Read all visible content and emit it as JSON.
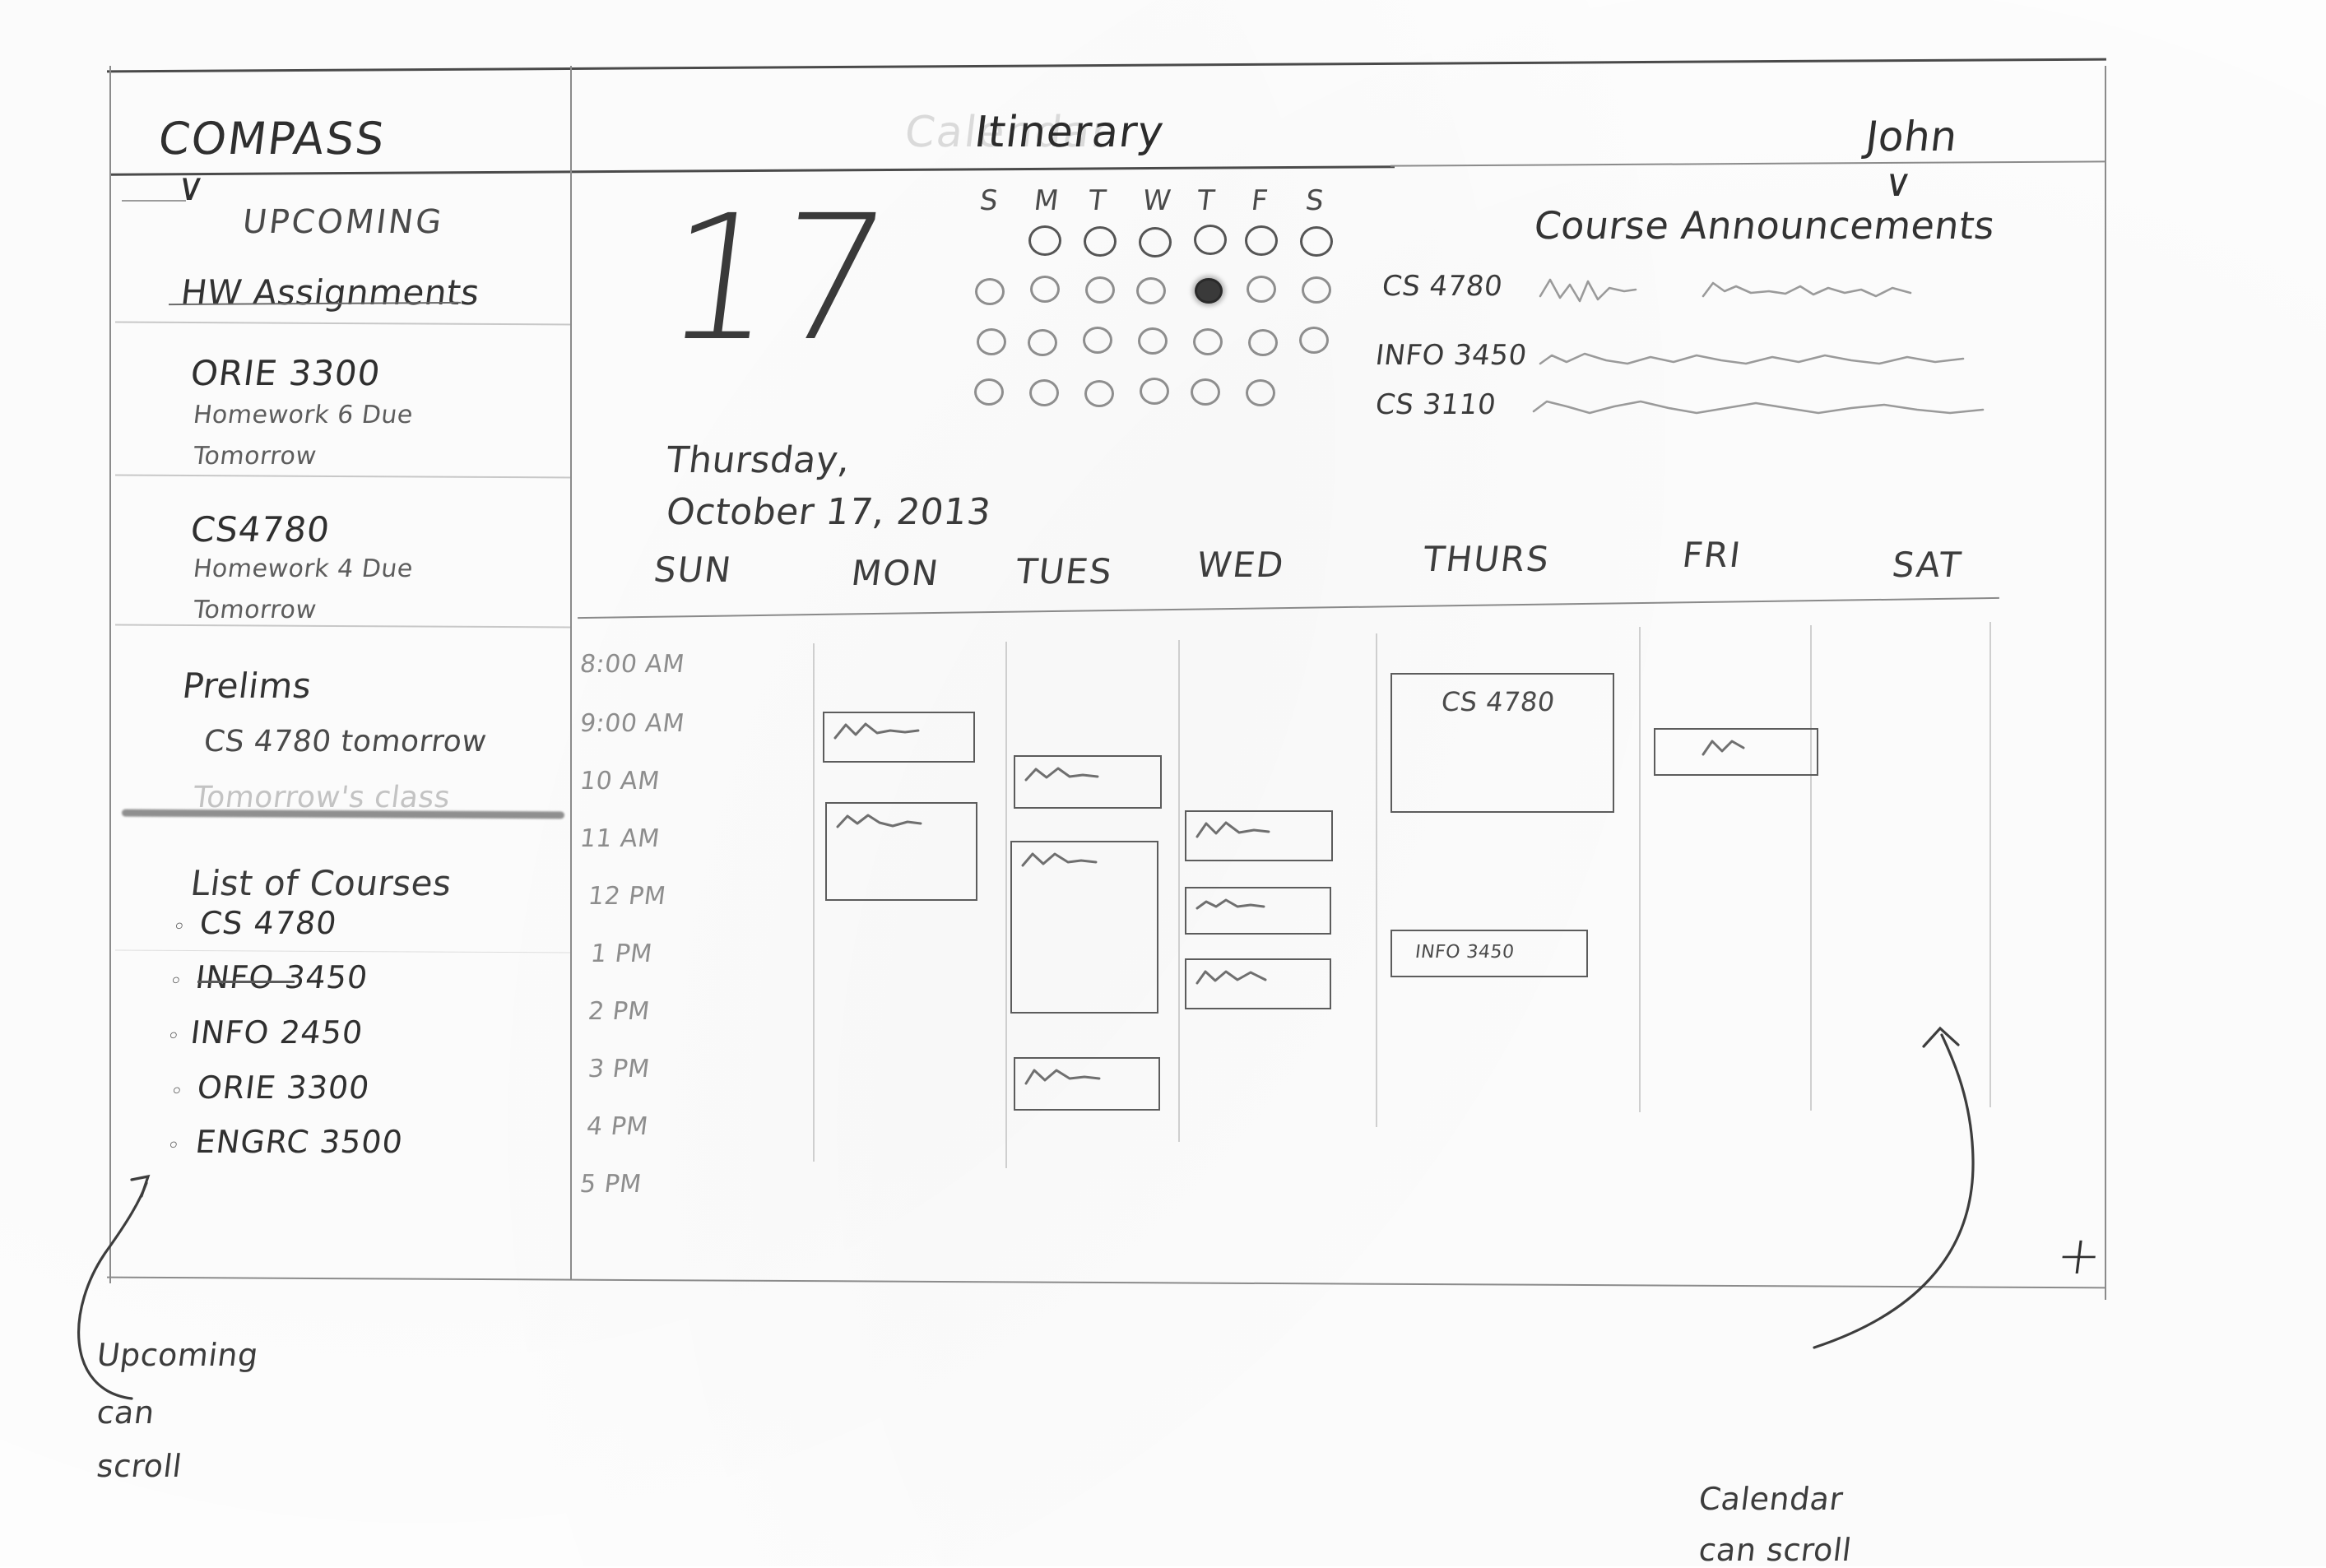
{
  "header": {
    "logo": "COMPASS",
    "logo_caret": "∨",
    "title": "Itinerary",
    "title_ghost": "Calendar",
    "user": "John",
    "user_caret": "∨"
  },
  "sidebar": {
    "section_label": "UPCOMING",
    "hw_heading": "HW Assignments",
    "hw_items": [
      {
        "course": "ORIE 3300",
        "detail_line1": "Homework 6 Due",
        "detail_line2": "Tomorrow"
      },
      {
        "course": "CS4780",
        "detail_line1": "Homework 4 Due",
        "detail_line2": "Tomorrow"
      }
    ],
    "prelims_heading": "Prelims",
    "prelims_items": [
      {
        "text": "CS 4780 tomorrow"
      }
    ],
    "erased_text": "Tomorrow's class",
    "courses_heading": "List of Courses",
    "courses": [
      {
        "bullet": "◦",
        "label": "CS 4780"
      },
      {
        "bullet": "◦",
        "label": "INFO 3450"
      },
      {
        "bullet": "◦",
        "label": "INFO 2450"
      },
      {
        "bullet": "◦",
        "label": "ORIE 3300"
      },
      {
        "bullet": "◦",
        "label": "ENGRC 3500"
      }
    ]
  },
  "datepanel": {
    "day_number": "17",
    "full_date_line1": "Thursday,",
    "full_date_line2": "October 17, 2013",
    "mini_calendar": {
      "dow_labels": [
        "S",
        "M",
        "T",
        "W",
        "T",
        "F",
        "S"
      ],
      "weeks": [
        [
          null,
          "o",
          "o",
          "o",
          "o",
          "o",
          "o"
        ],
        [
          "o",
          "o",
          "o",
          "o",
          "selected",
          "o",
          "o"
        ],
        [
          "o",
          "o",
          "o",
          "o",
          "o",
          "o",
          "o"
        ],
        [
          "o",
          "o",
          "o",
          "o",
          "o",
          "o",
          null
        ]
      ],
      "selected_day": "17"
    }
  },
  "announcements": {
    "heading": "Course Announcements",
    "items": [
      {
        "course": "CS 4780",
        "body": "squiggle-placeholder-text"
      },
      {
        "course": "INFO 3450",
        "body": "squiggle-placeholder-text"
      },
      {
        "course": "CS 3110",
        "body": "squiggle-placeholder-text"
      }
    ]
  },
  "calendar": {
    "day_headers": [
      "SUN",
      "MON",
      "TUES",
      "WED",
      "THURS",
      "FRI",
      "SAT"
    ],
    "time_labels": [
      "8:00 AM",
      "9:00 AM",
      "10 AM",
      "11 AM",
      "12 PM",
      "1 PM",
      "2 PM",
      "3 PM",
      "4 PM",
      "5 PM"
    ],
    "events": [
      {
        "day": "MON",
        "label": "",
        "placeholder": "squiggle"
      },
      {
        "day": "MON",
        "label": "",
        "placeholder": "squiggle"
      },
      {
        "day": "TUES",
        "label": "",
        "placeholder": "squiggle"
      },
      {
        "day": "TUES",
        "label": "",
        "placeholder": "squiggle"
      },
      {
        "day": "TUES",
        "label": "",
        "placeholder": "squiggle"
      },
      {
        "day": "WED",
        "label": "",
        "placeholder": "squiggle"
      },
      {
        "day": "WED",
        "label": "",
        "placeholder": "squiggle"
      },
      {
        "day": "WED",
        "label": "",
        "placeholder": "squiggle"
      },
      {
        "day": "THURS",
        "label": "CS 4780",
        "placeholder": ""
      },
      {
        "day": "THURS",
        "label": "INFO 3450",
        "placeholder": ""
      },
      {
        "day": "FRI",
        "label": "",
        "placeholder": "squiggle"
      }
    ],
    "add_button": "+"
  },
  "annotations": [
    {
      "id": "upcoming-scroll",
      "line1": "Upcoming",
      "line2": "can",
      "line3": "scroll"
    },
    {
      "id": "calendar-scroll",
      "line1": "Calendar",
      "line2": "can scroll"
    }
  ],
  "colors": {
    "pencil_dark": "#2f2f2f",
    "pencil_mid": "#6e6e6e",
    "pencil_light": "#b8b8b8",
    "paper": "#fefefe"
  }
}
